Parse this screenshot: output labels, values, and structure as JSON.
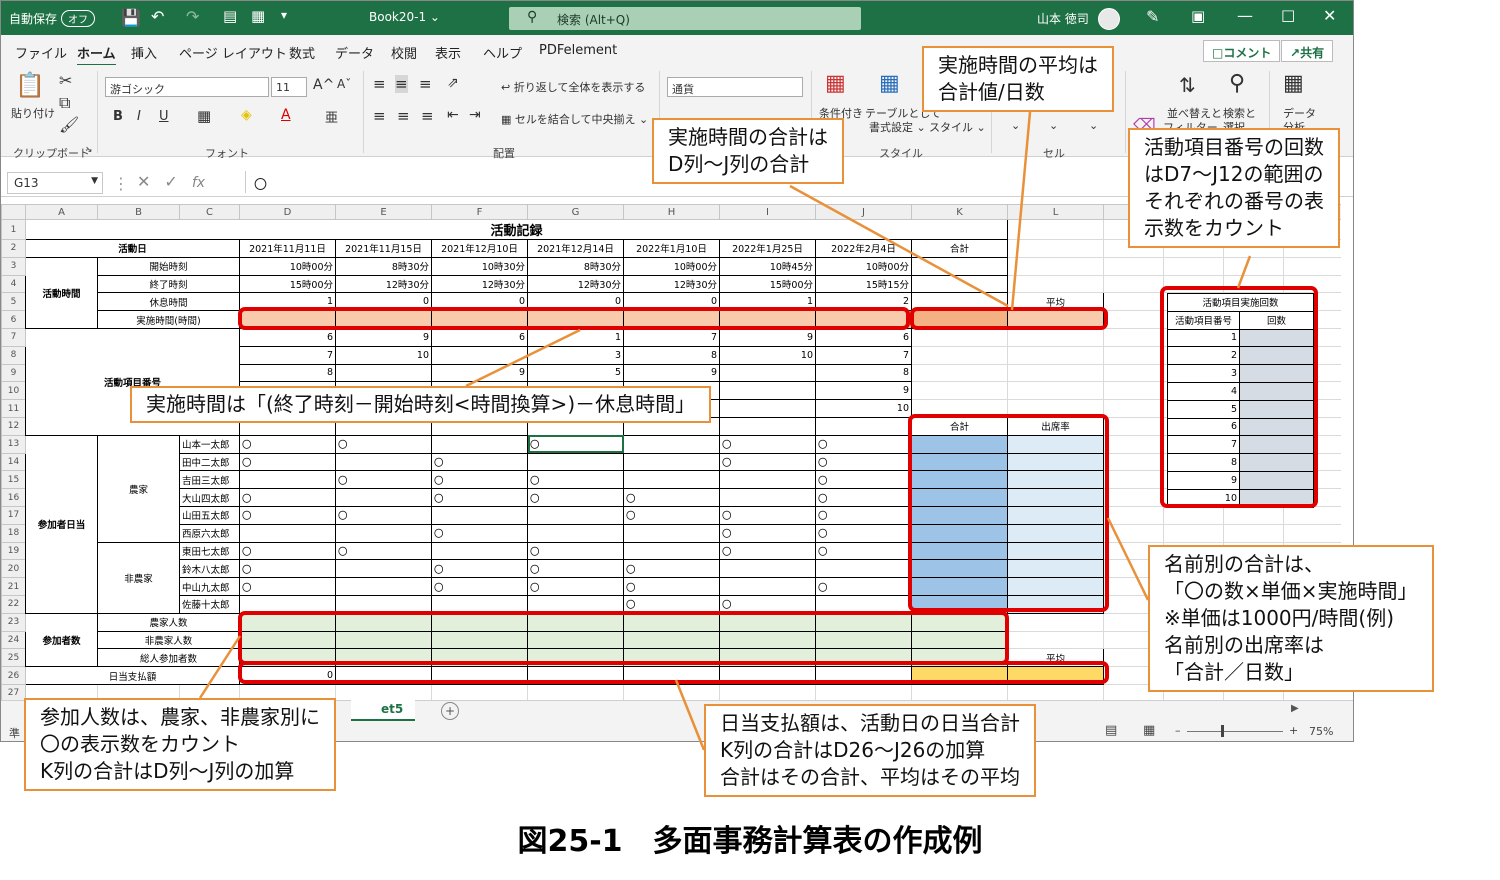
{
  "titlebar": {
    "autosave_label": "自動保存",
    "autosave_state": "オフ",
    "filename": "Book20-1",
    "search": "検索 (Alt+Q)",
    "user": "山本 徳司"
  },
  "menu": [
    "ファイル",
    "ホーム",
    "挿入",
    "ページ レイアウト",
    "数式",
    "データ",
    "校閲",
    "表示",
    "ヘルプ",
    "PDFelement"
  ],
  "menu_active": "ホーム",
  "menu_buttons": {
    "comment": "コメント",
    "share": "共有"
  },
  "ribbon": {
    "paste": "貼り付け",
    "clipboard": "クリップボード",
    "font_name": "游ゴシック",
    "font_size": "11",
    "font_group": "フォント",
    "wrap_text": "折り返して全体を表示する",
    "merge_center": "セルを結合して中央揃え",
    "align_group": "配置",
    "number_format": "通貨",
    "cond_format": "条件付き",
    "table_format": "テーブルとして",
    "table_format2": "書式設定",
    "cell_style": "スタイル",
    "style_group": "スタイル",
    "cells_group": "セル",
    "sort_filter": "並べ替えと",
    "sort_filter2": "フィルター",
    "find_select": "検索と",
    "find_select2": "選択",
    "data_analysis": "データ",
    "data_analysis2": "分析",
    "bold": "B",
    "italic": "I",
    "underline": "U",
    "font_color": "A"
  },
  "formula_bar": {
    "name_box": "G13",
    "fx": "fx",
    "content": "〇"
  },
  "sheet": {
    "col_headers": [
      "A",
      "B",
      "C",
      "D",
      "E",
      "F",
      "G",
      "H",
      "I",
      "J",
      "K",
      "L",
      "",
      "",
      "",
      ""
    ],
    "title": "活動記録",
    "activity_day": "活動日",
    "dates": [
      "2021年11月11日",
      "2021年11月15日",
      "2021年12月10日",
      "2021年12月14日",
      "2022年1月10日",
      "2022年1月25日",
      "2022年2月4日"
    ],
    "total": "合計",
    "start_time": "開始時刻",
    "end_time": "終了時刻",
    "break_time": "休息時間",
    "work_hours": "実施時間(時間)",
    "activity_time": "活動時間",
    "starts": [
      "10時00分",
      "8時30分",
      "10時30分",
      "8時30分",
      "10時00分",
      "10時45分",
      "10時00分"
    ],
    "ends": [
      "15時00分",
      "12時30分",
      "12時30分",
      "12時30分",
      "12時30分",
      "15時00分",
      "15時15分"
    ],
    "breaks": [
      "1",
      "0",
      "0",
      "0",
      "0",
      "1",
      "2"
    ],
    "average": "平均",
    "activity_no": "活動項目番号",
    "item_rows": [
      [
        "6",
        "9",
        "6",
        "1",
        "7",
        "9",
        "6"
      ],
      [
        "7",
        "10",
        "",
        "3",
        "8",
        "10",
        "7"
      ],
      [
        "8",
        "",
        "9",
        "5",
        "9",
        "",
        "8"
      ],
      [
        "",
        "",
        "",
        "",
        "",
        "",
        "9"
      ],
      [
        "",
        "",
        "",
        "",
        "",
        "",
        "10"
      ]
    ],
    "sum_label": "合計",
    "attendance": "出席率",
    "participant_pay": "参加者日当",
    "farmer": "農家",
    "nonfarmer": "非農家",
    "names": [
      "山本一太郎",
      "田中二太郎",
      "吉田三太郎",
      "大山四太郎",
      "山田五太郎",
      "西原六太郎",
      "東田七太郎",
      "鈴木八太郎",
      "中山九太郎",
      "佐藤十太郎"
    ],
    "marks": [
      [
        "〇",
        "〇",
        "",
        "〇",
        "",
        "〇",
        "〇"
      ],
      [
        "〇",
        "",
        "〇",
        "",
        "",
        "〇",
        "〇"
      ],
      [
        "",
        "〇",
        "〇",
        "〇",
        "",
        "",
        "〇"
      ],
      [
        "〇",
        "",
        "〇",
        "〇",
        "〇",
        "",
        "〇"
      ],
      [
        "〇",
        "〇",
        "",
        "",
        "〇",
        "〇",
        "〇"
      ],
      [
        "",
        "",
        "〇",
        "",
        "",
        "〇",
        "〇"
      ],
      [
        "〇",
        "〇",
        "",
        "〇",
        "",
        "〇",
        "〇"
      ],
      [
        "〇",
        "",
        "〇",
        "〇",
        "〇",
        "",
        ""
      ],
      [
        "〇",
        "",
        "〇",
        "〇",
        "〇",
        "",
        "〇"
      ],
      [
        "",
        "",
        "",
        "",
        "〇",
        "〇",
        ""
      ]
    ],
    "participants": "参加者数",
    "farmer_count": "農家人数",
    "nonfarmer_count": "非農家人数",
    "total_count": "総人参加者数",
    "daily_pay": "日当支払額",
    "daily_pay_d": "0",
    "freq_title": "活動項目実施回数",
    "freq_no": "活動項目番号",
    "freq_count": "回数",
    "freq_numbers": [
      "1",
      "2",
      "3",
      "4",
      "5",
      "6",
      "7",
      "8",
      "9",
      "10"
    ]
  },
  "tabbar": {
    "sheet_tab": "et5",
    "add": "+"
  },
  "status": {
    "ready": "準",
    "zoom": "75%"
  },
  "callouts": {
    "avg": [
      "実施時間の平均は",
      "合計値/日数"
    ],
    "sum": [
      "実施時間の合計は",
      "D列～J列の合計"
    ],
    "freq": [
      "活動項目番号の回数",
      "はD7～J12の範囲の",
      "それぞれの番号の表",
      "示数をカウント"
    ],
    "work": [
      "実施時間は「(終了時刻－開始時刻<時間換算>)－休息時間」"
    ],
    "name": [
      "名前別の合計は、",
      "「〇の数×単価×実施時間」",
      "※単価は1000円/時間(例)",
      "名前別の出席率は",
      "「合計／日数」"
    ],
    "count": [
      "参加人数は、農家、非農家別に",
      "〇の表示数をカウント",
      "K列の合計はD列～J列の加算"
    ],
    "pay": [
      "日当支払額は、活動日の日当合計",
      "K列の合計はD26～J26の加算",
      "合計はその合計、平均はその平均"
    ]
  },
  "caption": "図25-1　多面事務計算表の作成例"
}
